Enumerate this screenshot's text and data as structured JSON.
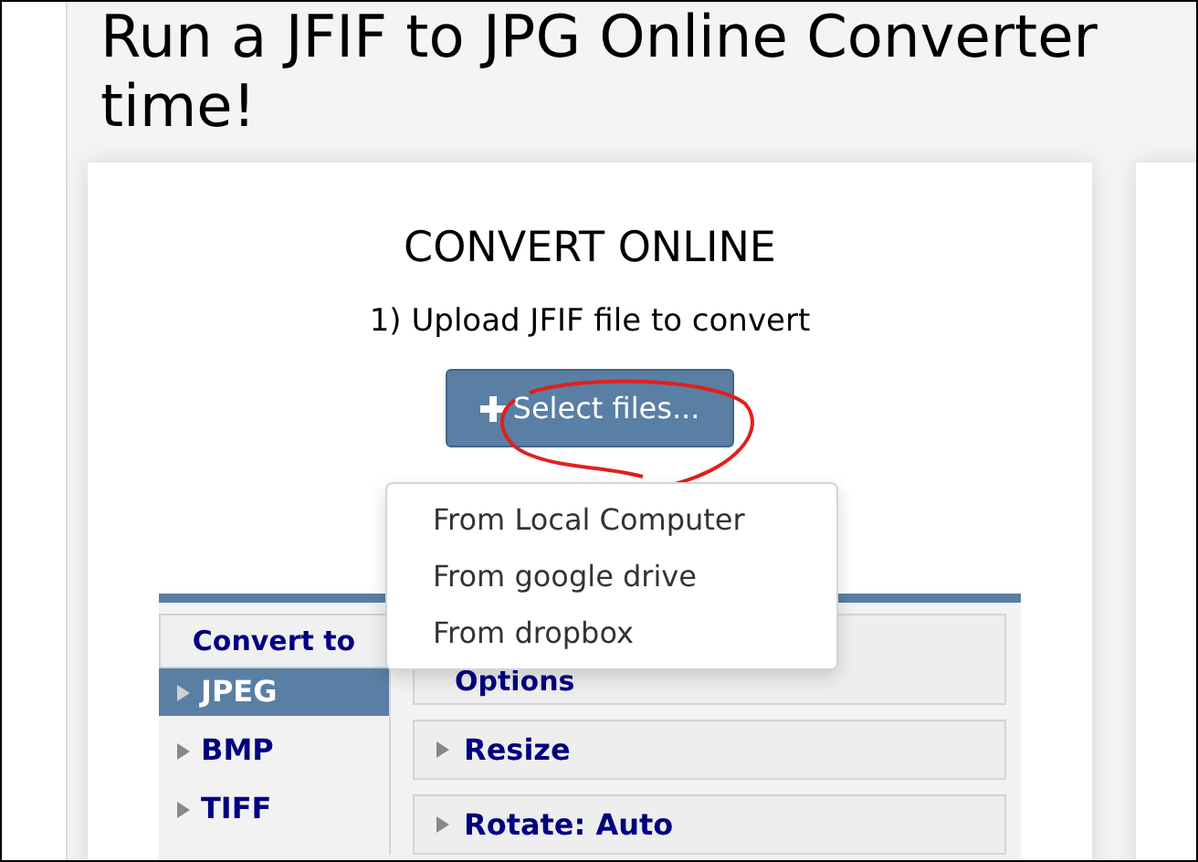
{
  "headline": [
    "Run a JFIF to JPG Online Converter",
    "time!"
  ],
  "converter": {
    "title": "CONVERT ONLINE",
    "step": "1) Upload JFIF file to convert",
    "select_button": "Select files...",
    "menu": {
      "expanded": true,
      "items": [
        "From Local Computer",
        "From google drive",
        "From dropbox"
      ]
    },
    "formats": {
      "heading": "Convert to",
      "items": [
        {
          "label": "JPEG",
          "selected": true
        },
        {
          "label": "BMP",
          "selected": false
        },
        {
          "label": "TIFF",
          "selected": false
        }
      ]
    },
    "options": {
      "heading": "Options",
      "sections": [
        "Resize",
        "Rotate: Auto"
      ]
    }
  }
}
